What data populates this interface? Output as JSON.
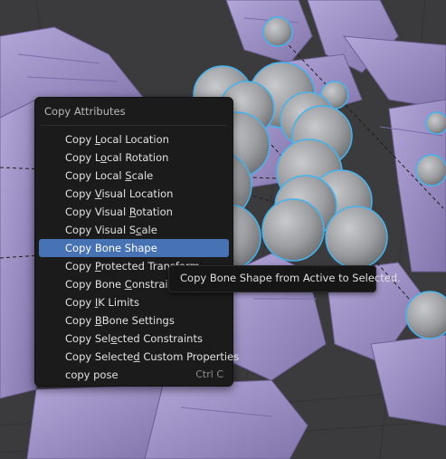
{
  "menu": {
    "title": "Copy Attributes",
    "items": [
      {
        "pre": "Copy ",
        "ul": "L",
        "post": "ocal Location",
        "shortcut": ""
      },
      {
        "pre": "Copy L",
        "ul": "o",
        "post": "cal Rotation",
        "shortcut": ""
      },
      {
        "pre": "Copy Local ",
        "ul": "S",
        "post": "cale",
        "shortcut": ""
      },
      {
        "pre": "Copy ",
        "ul": "V",
        "post": "isual Location",
        "shortcut": ""
      },
      {
        "pre": "Copy Visual ",
        "ul": "R",
        "post": "otation",
        "shortcut": ""
      },
      {
        "pre": "Copy Visual S",
        "ul": "c",
        "post": "ale",
        "shortcut": ""
      },
      {
        "pre": "Copy Bone Shape",
        "ul": "",
        "post": "",
        "shortcut": ""
      },
      {
        "pre": "Copy ",
        "ul": "P",
        "post": "rotected Transform",
        "shortcut": ""
      },
      {
        "pre": "Copy Bone ",
        "ul": "C",
        "post": "onstraints",
        "shortcut": ""
      },
      {
        "pre": "Copy ",
        "ul": "I",
        "post": "K Limits",
        "shortcut": ""
      },
      {
        "pre": "Copy ",
        "ul": "B",
        "post": "Bone Settings",
        "shortcut": ""
      },
      {
        "pre": "Copy Sel",
        "ul": "e",
        "post": "cted Constraints",
        "shortcut": ""
      },
      {
        "pre": "Copy Selecte",
        "ul": "d",
        "post": " Custom Properties",
        "shortcut": ""
      },
      {
        "pre": "copy pose",
        "ul": "",
        "post": "",
        "shortcut": "Ctrl C"
      }
    ],
    "active_index": 6
  },
  "tooltip": {
    "text": "Copy Bone Shape from Active to Selected."
  },
  "colors": {
    "viewport_bg": "#3a3a3c",
    "mesh": "#a597cc",
    "sphere": "#9ea0a3",
    "sphere_outline": "#46b4ee",
    "menu_bg": "#1b1b1b",
    "highlight": "#4772b3"
  }
}
